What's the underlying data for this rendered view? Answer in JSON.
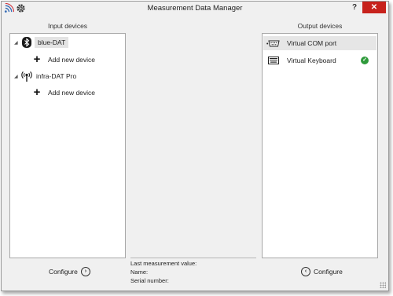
{
  "window": {
    "title": "Measurement Data Manager"
  },
  "titlebar": {
    "help_label": "?",
    "close_label": "✕"
  },
  "input": {
    "label": "Input devices",
    "devices": [
      {
        "name": "blue-DAT",
        "icon": "bluetooth-icon",
        "add_label": "Add new device"
      },
      {
        "name": "infra-DAT Pro",
        "icon": "infrared-icon",
        "add_label": "Add new device"
      }
    ],
    "configure_label": "Configure"
  },
  "output": {
    "label": "Output devices",
    "devices": [
      {
        "name": "Virtual COM port",
        "icon": "serial-port-icon",
        "active": false
      },
      {
        "name": "Virtual Keyboard",
        "icon": "keyboard-icon",
        "active": true
      }
    ],
    "configure_label": "Configure"
  },
  "info": {
    "last_measurement_label": "Last measurement value:",
    "name_label": "Name:",
    "serial_label": "Serial number:"
  },
  "colors": {
    "close": "#c7221c",
    "check": "#2e9a3a",
    "app_icon": "#3b6fb6"
  }
}
